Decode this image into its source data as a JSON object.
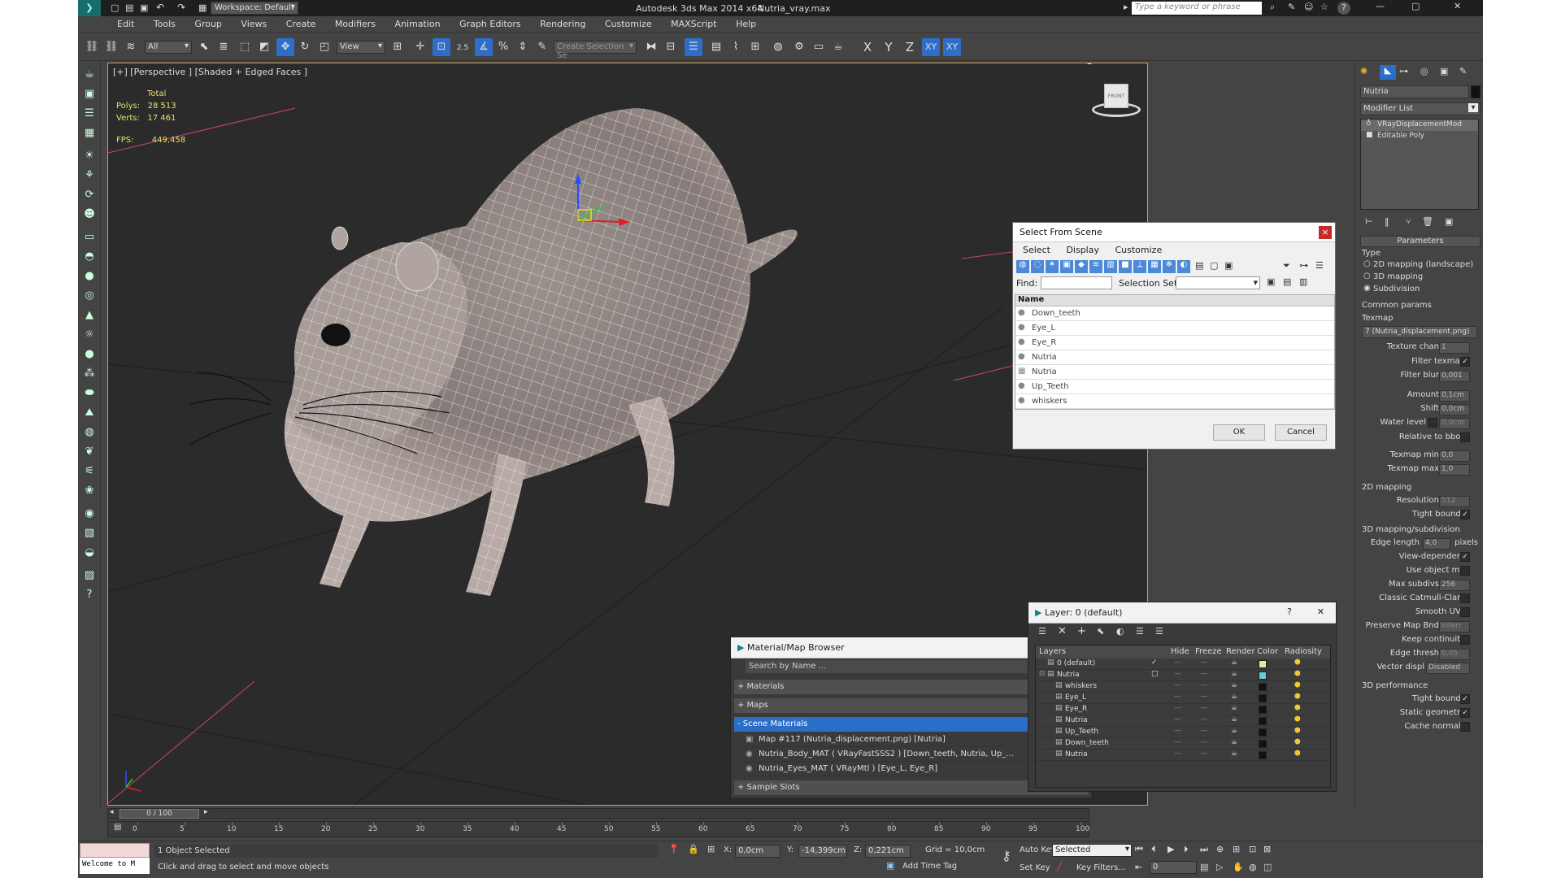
{
  "titlebar": {
    "workspace": "Workspace: Default",
    "app_title": "Autodesk 3ds Max  2014 x64",
    "file_name": "Nutria_vray.max",
    "search_placeholder": "Type a keyword or phrase",
    "help": "?"
  },
  "menu": [
    "Edit",
    "Tools",
    "Group",
    "Views",
    "Create",
    "Modifiers",
    "Animation",
    "Graph Editors",
    "Rendering",
    "Customize",
    "MAXScript",
    "Help"
  ],
  "toolbar": {
    "selection_filter": "All",
    "ref_coord": "View",
    "named_selection_placeholder": "Create Selection Se",
    "snap_label": "2.5",
    "axis_x": "X",
    "axis_y": "Y",
    "axis_z": "Z",
    "axis_xy": "XY",
    "axis_xy2": "XY"
  },
  "viewport": {
    "label": "[+] [Perspective ] [Shaded + Edged Faces ]",
    "stats_header": "Total",
    "polys_label": "Polys:",
    "polys_value": "28 513",
    "verts_label": "Verts:",
    "verts_value": "17 461",
    "fps_label": "FPS:",
    "fps_value": "449,458",
    "viewcube_label": "FRONT"
  },
  "select_from_scene": {
    "title": "Select From Scene",
    "menu": [
      "Select",
      "Display",
      "Customize"
    ],
    "find_label": "Find:",
    "selection_set_label": "Selection Set:",
    "column_name": "Name",
    "items": [
      "Down_teeth",
      "Eye_L",
      "Eye_R",
      "Nutria",
      "Nutria",
      "Up_Teeth",
      "whiskers"
    ],
    "ok": "OK",
    "cancel": "Cancel"
  },
  "layer_dialog": {
    "title": "Layer: 0 (default)",
    "help": "?",
    "columns": [
      "Layers",
      "Hide",
      "Freeze",
      "Render",
      "Color",
      "Radiosity"
    ],
    "rows": [
      {
        "name": "0 (default)",
        "color": "#e8e8a0",
        "check": "✓"
      },
      {
        "name": "Nutria",
        "color": "#5fd0d8",
        "check": "□"
      },
      {
        "name": "whiskers",
        "color": "#111111",
        "check": ""
      },
      {
        "name": "Eye_L",
        "color": "#111111",
        "check": ""
      },
      {
        "name": "Eye_R",
        "color": "#111111",
        "check": ""
      },
      {
        "name": "Nutria",
        "color": "#111111",
        "check": ""
      },
      {
        "name": "Up_Teeth",
        "color": "#111111",
        "check": ""
      },
      {
        "name": "Down_teeth",
        "color": "#111111",
        "check": ""
      },
      {
        "name": "Nutria",
        "color": "#111111",
        "check": ""
      }
    ]
  },
  "material_browser": {
    "title": "Material/Map Browser",
    "search_placeholder": "Search by Name ...",
    "materials": "+ Materials",
    "maps": "+ Maps",
    "scene_materials": "- Scene Materials",
    "items": [
      "Map #117 (Nutria_displacement.png) [Nutria]",
      "Nutria_Body_MAT ( VRayFastSSS2 ) [Down_teeth, Nutria, Up_...",
      "Nutria_Eyes_MAT ( VRayMtl ) [Eye_L, Eye_R]"
    ],
    "sample_slots": "+ Sample Slots"
  },
  "command_panel": {
    "object_name": "Nutria",
    "modifier_list": "Modifier List",
    "stack": [
      "VRayDisplacementMod",
      "Editable Poly"
    ],
    "parameters_header": "Parameters",
    "type_label": "Type",
    "type_options": [
      "2D mapping (landscape)",
      "3D mapping",
      "Subdivision"
    ],
    "common_params": "Common params",
    "texmap_label": "Texmap",
    "texmap_value": "7 (Nutria_displacement.png)",
    "texture_chan_label": "Texture chan",
    "texture_chan_value": "1",
    "filter_texmap_label": "Filter texmap",
    "filter_blur_label": "Filter blur",
    "filter_blur_value": "0,001",
    "amount_label": "Amount",
    "amount_value": "0,1cm",
    "shift_label": "Shift",
    "shift_value": "0,0cm",
    "water_level_label": "Water level",
    "water_level_value": "0,0cm",
    "relative_bbox_label": "Relative to bbox",
    "texmap_min_label": "Texmap min",
    "texmap_min_value": "0,0",
    "texmap_max_label": "Texmap max",
    "texmap_max_value": "1,0",
    "mapping2d_header": "2D mapping",
    "resolution_label": "Resolution",
    "resolution_value": "512",
    "tight_bounds_label": "Tight bounds",
    "mapping3d_header": "3D mapping/subdivision",
    "edge_length_label": "Edge length",
    "edge_length_value": "4,0",
    "pixels_label": "pixels",
    "view_dependent_label": "View-dependent",
    "use_object_mtl_label": "Use object mtl",
    "max_subdivs_label": "Max subdivs",
    "max_subdivs_value": "256",
    "classic_catmull_label": "Classic Catmull-Clark",
    "smooth_uvs_label": "Smooth UVs",
    "preserve_map_bnd_label": "Preserve Map Bnd",
    "preserve_map_bnd_value": "Interr",
    "keep_continuity_label": "Keep continuity",
    "edge_thresh_label": "Edge thresh",
    "edge_thresh_value": "0,05",
    "vector_displ_label": "Vector displ",
    "vector_displ_value": "Disabled",
    "perf_header": "3D performance",
    "tight_bounds2_label": "Tight bounds",
    "static_geometry_label": "Static geometry",
    "cache_normals_label": "Cache normals"
  },
  "timeline": {
    "frame_counter": "0 / 100",
    "ticks": [
      "0",
      "5",
      "10",
      "15",
      "20",
      "25",
      "30",
      "35",
      "40",
      "45",
      "50",
      "55",
      "60",
      "65",
      "70",
      "75",
      "80",
      "85",
      "90",
      "95",
      "100"
    ]
  },
  "status": {
    "welcome": "Welcome to M",
    "selected": "1 Object Selected",
    "hint": "Click and drag to select and move objects",
    "x_label": "X:",
    "x_value": "0,0cm",
    "y_label": "Y:",
    "y_value": "-14,399cm",
    "z_label": "Z:",
    "z_value": "0,221cm",
    "grid": "Grid = 10,0cm",
    "add_time_tag": "Add Time Tag",
    "auto_key": "Auto Key",
    "set_key": "Set Key",
    "selected_dropdown": "Selected",
    "key_filters": "Key Filters...",
    "frame_value": "0"
  }
}
